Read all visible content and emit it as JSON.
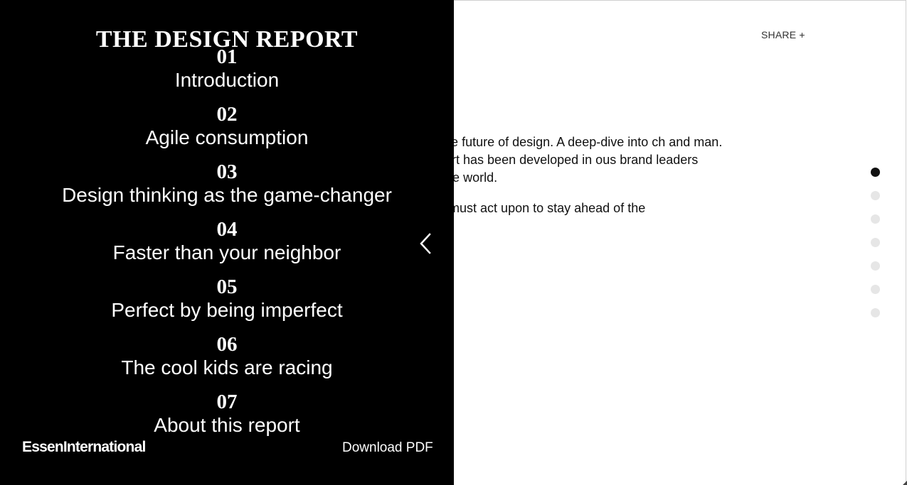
{
  "header": {
    "share_label": "SHARE +"
  },
  "intro": {
    "paragraphs": [
      "on into the future of design. A deep-dive into ch and man. This report has been developed in ous brand leaders around the world.",
      "at we all must act upon to stay ahead of the"
    ]
  },
  "page_dots": {
    "count": 7,
    "active_index": 0
  },
  "menu": {
    "title": "THE DESIGN REPORT",
    "items": [
      {
        "number": "01",
        "label": "Introduction"
      },
      {
        "number": "02",
        "label": "Agile consumption"
      },
      {
        "number": "03",
        "label": "Design thinking as the game-changer"
      },
      {
        "number": "04",
        "label": "Faster than your neighbor"
      },
      {
        "number": "05",
        "label": "Perfect by being imperfect"
      },
      {
        "number": "06",
        "label": "The cool kids are racing"
      },
      {
        "number": "07",
        "label": "About this report"
      }
    ],
    "collapse_icon": "chevron-left-icon",
    "brand": "EssenInternational",
    "download_label": "Download PDF"
  },
  "colors": {
    "menu_background": "#000000",
    "menu_text": "#ffffff",
    "active_dot": "#111111",
    "inactive_dot": "#e6e6e6"
  }
}
